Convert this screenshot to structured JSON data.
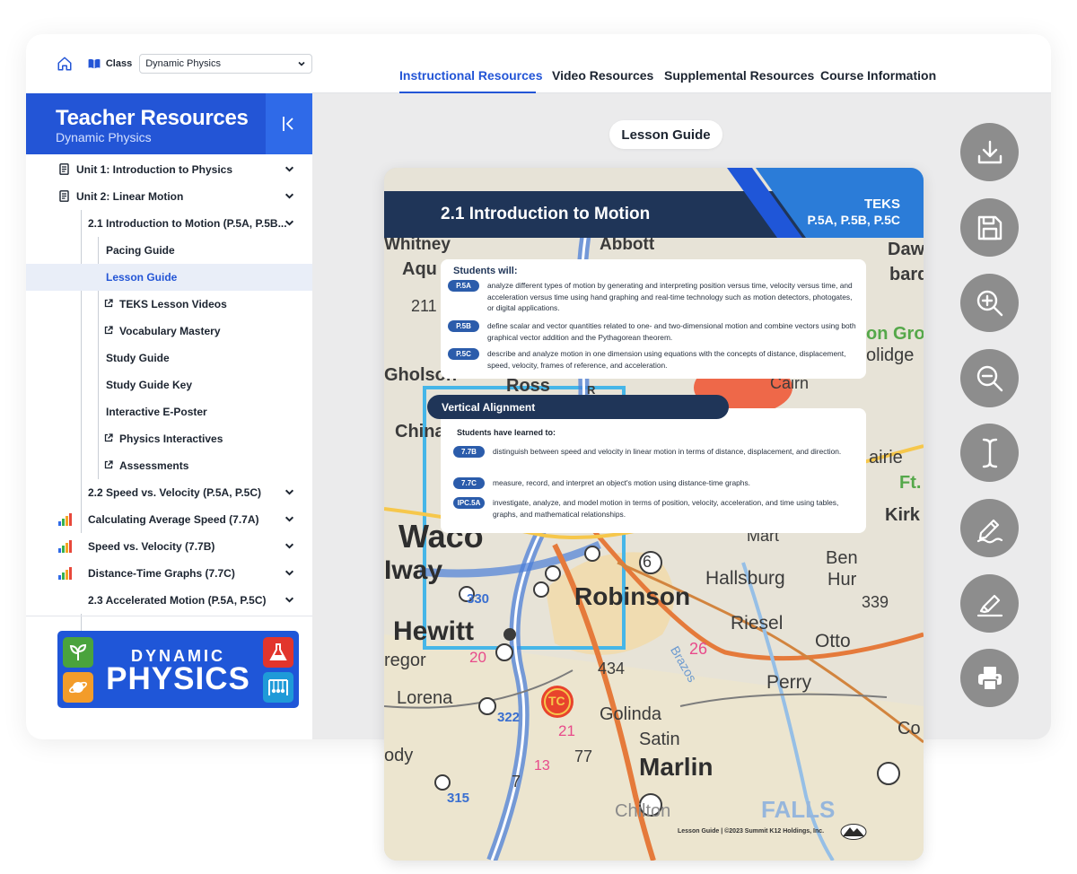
{
  "topbar": {
    "class_label": "Class",
    "class_value": "Dynamic Physics"
  },
  "tabs": [
    {
      "label": "Instructional Resources",
      "active": true
    },
    {
      "label": "Video Resources",
      "active": false
    },
    {
      "label": "Supplemental Resources",
      "active": false
    },
    {
      "label": "Course Information",
      "active": false
    }
  ],
  "sidebar": {
    "title": "Teacher Resources",
    "subtitle": "Dynamic Physics",
    "items": [
      {
        "label": "Unit 1: Introduction to Physics",
        "icon": "document-icon"
      },
      {
        "label": "Unit 2: Linear Motion",
        "icon": "document-icon"
      },
      {
        "label": "2.1 Introduction to Motion (P.5A, P.5B..."
      },
      {
        "label": "Pacing Guide"
      },
      {
        "label": "Lesson Guide",
        "active": true
      },
      {
        "label": "TEKS Lesson Videos",
        "icon": "external-link-icon"
      },
      {
        "label": "Vocabulary Mastery",
        "icon": "external-link-icon"
      },
      {
        "label": "Study Guide"
      },
      {
        "label": "Study Guide Key"
      },
      {
        "label": "Interactive E-Poster"
      },
      {
        "label": "Physics Interactives",
        "icon": "external-link-icon"
      },
      {
        "label": "Assessments",
        "icon": "external-link-icon"
      },
      {
        "label": "2.2 Speed vs. Velocity (P.5A, P.5C)"
      },
      {
        "label": "Calculating Average Speed (7.7A)",
        "icon": "bar-chart-icon"
      },
      {
        "label": "Speed vs. Velocity (7.7B)",
        "icon": "bar-chart-icon"
      },
      {
        "label": "Distance-Time Graphs (7.7C)",
        "icon": "bar-chart-icon"
      },
      {
        "label": "2.3 Accelerated Motion (P.5A, P.5C)"
      }
    ],
    "logo_line1": "DYNAMIC",
    "logo_line2": "PHYSICS"
  },
  "viewer": {
    "chip_label": "Lesson Guide",
    "tools": [
      "download-icon",
      "save-icon",
      "zoom-in-icon",
      "zoom-out-icon",
      "text-cursor-icon",
      "pen-icon",
      "highlighter-icon",
      "print-icon"
    ]
  },
  "document": {
    "title": "2.1 Introduction to Motion",
    "teks_label": "TEKS",
    "teks_codes": "P.5A, P.5B, P.5C",
    "students_will_heading": "Students will:",
    "standards": [
      {
        "code": "P.5A",
        "text": "analyze different types of motion by generating and interpreting position versus time, velocity versus time, and acceleration versus time using hand graphing and real-time technology such as motion detectors, photogates, or digital applications."
      },
      {
        "code": "P.5B",
        "text": "define scalar and vector quantities related to one- and two-dimensional motion and combine vectors using both graphical vector addition and the Pythagorean theorem."
      },
      {
        "code": "P.5C",
        "text": "describe and analyze motion in one dimension using equations with the concepts of distance, displacement, speed, velocity, frames of reference, and acceleration."
      }
    ],
    "vertical_alignment_title": "Vertical Alignment",
    "learned_heading": "Students have learned to:",
    "prior_standards": [
      {
        "code": "7.7B",
        "text": "distinguish between speed and velocity in linear motion in terms of distance, displacement, and direction."
      },
      {
        "code": "7.7C",
        "text": "measure, record, and interpret an object's motion using distance-time graphs."
      },
      {
        "code": "IPC.5A",
        "text": "investigate, analyze, and model motion in terms of position, velocity, acceleration, and time using tables, graphs, and mathematical relationships."
      }
    ],
    "footer": "Lesson Guide  |  ©2023 Summit K12 Holdings, Inc.",
    "map_labels": [
      "Whitney",
      "Abbott",
      "Dawso",
      "bard",
      "Aqu",
      "Ross",
      "Gholson",
      "China",
      "Waco",
      "Iway",
      "Robinson",
      "Hallsburg",
      "Ben",
      "Hur",
      "Hewitt",
      "Riesel",
      "Otto",
      "Perry",
      "Lorena",
      "Golinda",
      "Satin",
      "Marlin",
      "Chilton",
      "FALLS",
      "Kirk",
      "Ft.",
      "airie",
      "olidge",
      "on Gro",
      "Cairn",
      "regor",
      "ody",
      "Co",
      "Mart",
      "Brazos",
      "211",
      "330",
      "339",
      "434",
      "322",
      "315",
      "77",
      "7",
      "6",
      "26",
      "20",
      "21",
      "13",
      "TC",
      "R"
    ]
  }
}
